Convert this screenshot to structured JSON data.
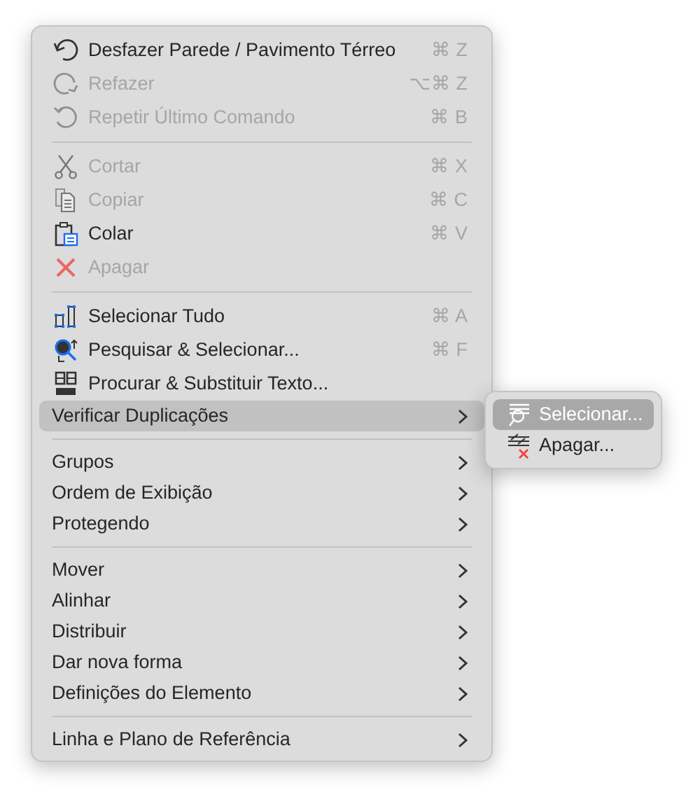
{
  "menu": [
    {
      "kind": "item",
      "label": "Desfazer Parede / Pavimento Térreo",
      "shortcut": "⌘ Z",
      "disabled": false,
      "selected": false
    },
    {
      "kind": "item",
      "label": "Refazer",
      "shortcut": "⌥⌘ Z",
      "disabled": true,
      "selected": false
    },
    {
      "kind": "item",
      "label": "Repetir Último Comando",
      "shortcut": "⌘ B",
      "disabled": true,
      "selected": false
    },
    {
      "kind": "separator"
    },
    {
      "kind": "item",
      "label": "Cortar",
      "shortcut": "⌘ X",
      "disabled": true,
      "selected": false
    },
    {
      "kind": "item",
      "label": "Copiar",
      "shortcut": "⌘ C",
      "disabled": true,
      "selected": false
    },
    {
      "kind": "item",
      "label": "Colar",
      "shortcut": "⌘ V",
      "disabled": false,
      "selected": false
    },
    {
      "kind": "item",
      "label": "Apagar",
      "disabled": true,
      "selected": false
    },
    {
      "kind": "separator"
    },
    {
      "kind": "item",
      "label": "Selecionar Tudo",
      "shortcut": "⌘ A",
      "disabled": false,
      "selected": false
    },
    {
      "kind": "item",
      "label": "Pesquisar & Selecionar...",
      "shortcut": "⌘ F",
      "disabled": false,
      "selected": false
    },
    {
      "kind": "item",
      "label": "Procurar & Substituir Texto...",
      "disabled": false,
      "selected": false
    },
    {
      "kind": "submenu",
      "label": "Verificar Duplicações",
      "selected": true
    },
    {
      "kind": "separator"
    },
    {
      "kind": "submenu",
      "label": "Grupos",
      "selected": false
    },
    {
      "kind": "submenu",
      "label": "Ordem de Exibição",
      "selected": false
    },
    {
      "kind": "submenu",
      "label": "Protegendo",
      "selected": false
    },
    {
      "kind": "separator"
    },
    {
      "kind": "submenu",
      "label": "Mover",
      "selected": false
    },
    {
      "kind": "submenu",
      "label": "Alinhar",
      "selected": false
    },
    {
      "kind": "submenu",
      "label": "Distribuir",
      "selected": false
    },
    {
      "kind": "submenu",
      "label": "Dar nova forma",
      "selected": false
    },
    {
      "kind": "submenu",
      "label": "Definições do Elemento",
      "selected": false
    },
    {
      "kind": "separator"
    },
    {
      "kind": "submenu",
      "label": "Linha e Plano de Referência",
      "selected": false
    }
  ],
  "submenu": [
    {
      "label": "Selecionar...",
      "selected": true
    },
    {
      "label": "Apagar...",
      "selected": false
    }
  ]
}
